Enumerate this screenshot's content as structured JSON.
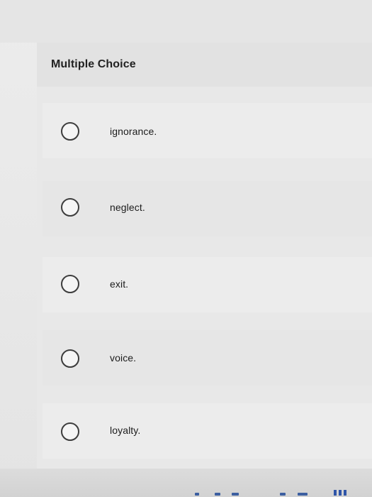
{
  "question": {
    "type_label": "Multiple Choice",
    "options": [
      {
        "label": "ignorance."
      },
      {
        "label": "neglect."
      },
      {
        "label": "exit."
      },
      {
        "label": "voice."
      },
      {
        "label": "loyalty."
      }
    ]
  },
  "icons": {
    "radio": "radio-button-unselected",
    "bottom_right": "grid-icon"
  },
  "colors": {
    "background": "#e8e8e8",
    "radio_border": "#3d3d3d",
    "text": "#1c1c1c",
    "accent": "#2f55a8"
  }
}
